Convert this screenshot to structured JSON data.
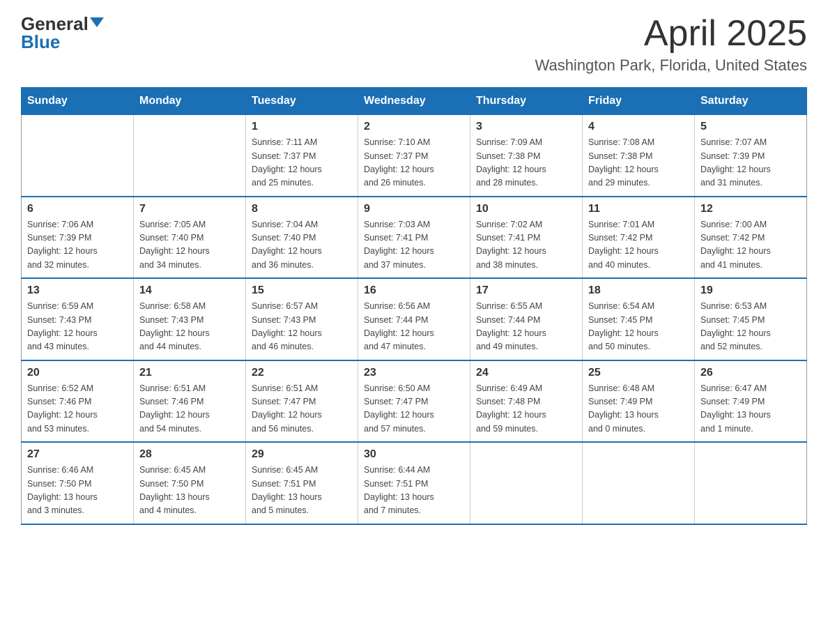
{
  "header": {
    "logo_line1": "General",
    "logo_line2": "Blue",
    "main_title": "April 2025",
    "subtitle": "Washington Park, Florida, United States"
  },
  "calendar": {
    "days_of_week": [
      "Sunday",
      "Monday",
      "Tuesday",
      "Wednesday",
      "Thursday",
      "Friday",
      "Saturday"
    ],
    "weeks": [
      [
        {
          "day": "",
          "info": ""
        },
        {
          "day": "",
          "info": ""
        },
        {
          "day": "1",
          "info": "Sunrise: 7:11 AM\nSunset: 7:37 PM\nDaylight: 12 hours\nand 25 minutes."
        },
        {
          "day": "2",
          "info": "Sunrise: 7:10 AM\nSunset: 7:37 PM\nDaylight: 12 hours\nand 26 minutes."
        },
        {
          "day": "3",
          "info": "Sunrise: 7:09 AM\nSunset: 7:38 PM\nDaylight: 12 hours\nand 28 minutes."
        },
        {
          "day": "4",
          "info": "Sunrise: 7:08 AM\nSunset: 7:38 PM\nDaylight: 12 hours\nand 29 minutes."
        },
        {
          "day": "5",
          "info": "Sunrise: 7:07 AM\nSunset: 7:39 PM\nDaylight: 12 hours\nand 31 minutes."
        }
      ],
      [
        {
          "day": "6",
          "info": "Sunrise: 7:06 AM\nSunset: 7:39 PM\nDaylight: 12 hours\nand 32 minutes."
        },
        {
          "day": "7",
          "info": "Sunrise: 7:05 AM\nSunset: 7:40 PM\nDaylight: 12 hours\nand 34 minutes."
        },
        {
          "day": "8",
          "info": "Sunrise: 7:04 AM\nSunset: 7:40 PM\nDaylight: 12 hours\nand 36 minutes."
        },
        {
          "day": "9",
          "info": "Sunrise: 7:03 AM\nSunset: 7:41 PM\nDaylight: 12 hours\nand 37 minutes."
        },
        {
          "day": "10",
          "info": "Sunrise: 7:02 AM\nSunset: 7:41 PM\nDaylight: 12 hours\nand 38 minutes."
        },
        {
          "day": "11",
          "info": "Sunrise: 7:01 AM\nSunset: 7:42 PM\nDaylight: 12 hours\nand 40 minutes."
        },
        {
          "day": "12",
          "info": "Sunrise: 7:00 AM\nSunset: 7:42 PM\nDaylight: 12 hours\nand 41 minutes."
        }
      ],
      [
        {
          "day": "13",
          "info": "Sunrise: 6:59 AM\nSunset: 7:43 PM\nDaylight: 12 hours\nand 43 minutes."
        },
        {
          "day": "14",
          "info": "Sunrise: 6:58 AM\nSunset: 7:43 PM\nDaylight: 12 hours\nand 44 minutes."
        },
        {
          "day": "15",
          "info": "Sunrise: 6:57 AM\nSunset: 7:43 PM\nDaylight: 12 hours\nand 46 minutes."
        },
        {
          "day": "16",
          "info": "Sunrise: 6:56 AM\nSunset: 7:44 PM\nDaylight: 12 hours\nand 47 minutes."
        },
        {
          "day": "17",
          "info": "Sunrise: 6:55 AM\nSunset: 7:44 PM\nDaylight: 12 hours\nand 49 minutes."
        },
        {
          "day": "18",
          "info": "Sunrise: 6:54 AM\nSunset: 7:45 PM\nDaylight: 12 hours\nand 50 minutes."
        },
        {
          "day": "19",
          "info": "Sunrise: 6:53 AM\nSunset: 7:45 PM\nDaylight: 12 hours\nand 52 minutes."
        }
      ],
      [
        {
          "day": "20",
          "info": "Sunrise: 6:52 AM\nSunset: 7:46 PM\nDaylight: 12 hours\nand 53 minutes."
        },
        {
          "day": "21",
          "info": "Sunrise: 6:51 AM\nSunset: 7:46 PM\nDaylight: 12 hours\nand 54 minutes."
        },
        {
          "day": "22",
          "info": "Sunrise: 6:51 AM\nSunset: 7:47 PM\nDaylight: 12 hours\nand 56 minutes."
        },
        {
          "day": "23",
          "info": "Sunrise: 6:50 AM\nSunset: 7:47 PM\nDaylight: 12 hours\nand 57 minutes."
        },
        {
          "day": "24",
          "info": "Sunrise: 6:49 AM\nSunset: 7:48 PM\nDaylight: 12 hours\nand 59 minutes."
        },
        {
          "day": "25",
          "info": "Sunrise: 6:48 AM\nSunset: 7:49 PM\nDaylight: 13 hours\nand 0 minutes."
        },
        {
          "day": "26",
          "info": "Sunrise: 6:47 AM\nSunset: 7:49 PM\nDaylight: 13 hours\nand 1 minute."
        }
      ],
      [
        {
          "day": "27",
          "info": "Sunrise: 6:46 AM\nSunset: 7:50 PM\nDaylight: 13 hours\nand 3 minutes."
        },
        {
          "day": "28",
          "info": "Sunrise: 6:45 AM\nSunset: 7:50 PM\nDaylight: 13 hours\nand 4 minutes."
        },
        {
          "day": "29",
          "info": "Sunrise: 6:45 AM\nSunset: 7:51 PM\nDaylight: 13 hours\nand 5 minutes."
        },
        {
          "day": "30",
          "info": "Sunrise: 6:44 AM\nSunset: 7:51 PM\nDaylight: 13 hours\nand 7 minutes."
        },
        {
          "day": "",
          "info": ""
        },
        {
          "day": "",
          "info": ""
        },
        {
          "day": "",
          "info": ""
        }
      ]
    ]
  }
}
